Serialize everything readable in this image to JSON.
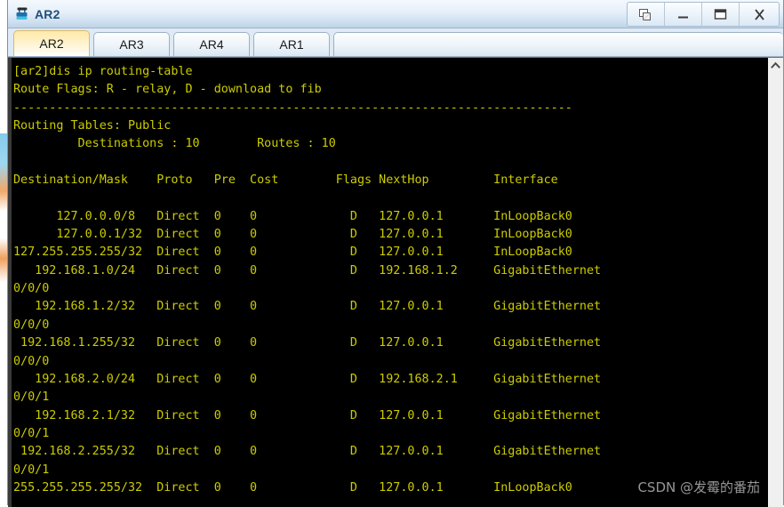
{
  "window": {
    "title": "AR2",
    "icon": "router-icon",
    "controls": [
      {
        "name": "restore-button",
        "glyph": "restore-icon"
      },
      {
        "name": "minimize-button",
        "glyph": "minimize-icon"
      },
      {
        "name": "maximize-button",
        "glyph": "maximize-icon"
      },
      {
        "name": "close-button",
        "glyph": "close-icon",
        "label": "X"
      }
    ]
  },
  "tabs": {
    "items": [
      {
        "label": "AR2",
        "active": true
      },
      {
        "label": "AR3",
        "active": false
      },
      {
        "label": "AR4",
        "active": false
      },
      {
        "label": "AR1",
        "active": false
      }
    ]
  },
  "console": {
    "prompt_line": "[ar2]dis ip routing-table",
    "route_flags_line": "Route Flags: R - relay, D - download to fib",
    "separator": "------------------------------------------------------------------------------",
    "routing_tables_line": "Routing Tables: Public",
    "summary_line": "         Destinations : 10        Routes : 10",
    "columns": [
      "Destination/Mask",
      "Proto",
      "Pre",
      "Cost",
      "Flags",
      "NextHop",
      "Interface"
    ],
    "header_line": "Destination/Mask    Proto   Pre  Cost        Flags NextHop         Interface",
    "routes": [
      {
        "destination": "127.0.0.0/8",
        "proto": "Direct",
        "pre": "0",
        "cost": "0",
        "flags": "D",
        "nexthop": "127.0.0.1",
        "interface": "InLoopBack0"
      },
      {
        "destination": "127.0.0.1/32",
        "proto": "Direct",
        "pre": "0",
        "cost": "0",
        "flags": "D",
        "nexthop": "127.0.0.1",
        "interface": "InLoopBack0"
      },
      {
        "destination": "127.255.255.255/32",
        "proto": "Direct",
        "pre": "0",
        "cost": "0",
        "flags": "D",
        "nexthop": "127.0.0.1",
        "interface": "InLoopBack0"
      },
      {
        "destination": "192.168.1.0/24",
        "proto": "Direct",
        "pre": "0",
        "cost": "0",
        "flags": "D",
        "nexthop": "192.168.1.2",
        "interface": "GigabitEthernet",
        "interface_cont": "0/0/0"
      },
      {
        "destination": "192.168.1.2/32",
        "proto": "Direct",
        "pre": "0",
        "cost": "0",
        "flags": "D",
        "nexthop": "127.0.0.1",
        "interface": "GigabitEthernet",
        "interface_cont": "0/0/0"
      },
      {
        "destination": "192.168.1.255/32",
        "proto": "Direct",
        "pre": "0",
        "cost": "0",
        "flags": "D",
        "nexthop": "127.0.0.1",
        "interface": "GigabitEthernet",
        "interface_cont": "0/0/0"
      },
      {
        "destination": "192.168.2.0/24",
        "proto": "Direct",
        "pre": "0",
        "cost": "0",
        "flags": "D",
        "nexthop": "192.168.2.1",
        "interface": "GigabitEthernet",
        "interface_cont": "0/0/1"
      },
      {
        "destination": "192.168.2.1/32",
        "proto": "Direct",
        "pre": "0",
        "cost": "0",
        "flags": "D",
        "nexthop": "127.0.0.1",
        "interface": "GigabitEthernet",
        "interface_cont": "0/0/1"
      },
      {
        "destination": "192.168.2.255/32",
        "proto": "Direct",
        "pre": "0",
        "cost": "0",
        "flags": "D",
        "nexthop": "127.0.0.1",
        "interface": "GigabitEthernet",
        "interface_cont": "0/0/1"
      },
      {
        "destination": "255.255.255.255/32",
        "proto": "Direct",
        "pre": "0",
        "cost": "0",
        "flags": "D",
        "nexthop": "127.0.0.1",
        "interface": "InLoopBack0"
      }
    ],
    "full_text": "[ar2]dis ip routing-table\nRoute Flags: R - relay, D - download to fib\n------------------------------------------------------------------------------\nRouting Tables: Public\n         Destinations : 10        Routes : 10\n\nDestination/Mask    Proto   Pre  Cost        Flags NextHop         Interface\n\n      127.0.0.0/8   Direct  0    0             D   127.0.0.1       InLoopBack0\n      127.0.0.1/32  Direct  0    0             D   127.0.0.1       InLoopBack0\n127.255.255.255/32  Direct  0    0             D   127.0.0.1       InLoopBack0\n   192.168.1.0/24   Direct  0    0             D   192.168.1.2     GigabitEthernet\n0/0/0\n   192.168.1.2/32   Direct  0    0             D   127.0.0.1       GigabitEthernet\n0/0/0\n 192.168.1.255/32   Direct  0    0             D   127.0.0.1       GigabitEthernet\n0/0/0\n   192.168.2.0/24   Direct  0    0             D   192.168.2.1     GigabitEthernet\n0/0/1\n   192.168.2.1/32   Direct  0    0             D   127.0.0.1       GigabitEthernet\n0/0/1\n 192.168.2.255/32   Direct  0    0             D   127.0.0.1       GigabitEthernet\n0/0/1\n255.255.255.255/32  Direct  0    0             D   127.0.0.1       InLoopBack0",
    "text_color": "#cccc00",
    "background_color": "#000000"
  },
  "scrollbar": {
    "up_arrow": "chevron-up-icon"
  },
  "watermark": {
    "text": "CSDN @发霉的番茄"
  }
}
